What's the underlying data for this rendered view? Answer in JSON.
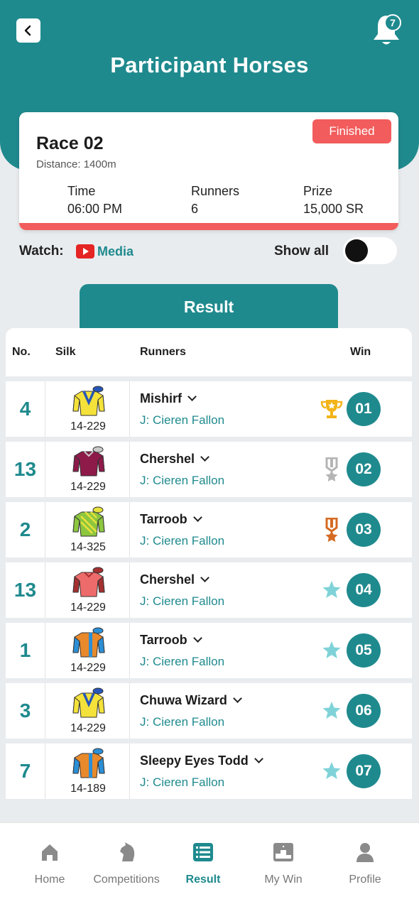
{
  "header": {
    "title": "Participant Horses",
    "notification_count": "7",
    "accent": "#1f8a8e"
  },
  "race": {
    "name": "Race 02",
    "distance": "Distance: 1400m",
    "status": "Finished",
    "time_label": "Time",
    "time_value": "06:00 PM",
    "runners_label": "Runners",
    "runners_value": "6",
    "prize_label": "Prize",
    "prize_value": "15,000 SR"
  },
  "watch": {
    "label": "Watch:",
    "media": "Media",
    "show_all": "Show all",
    "show_all_on": false
  },
  "result_tab": "Result",
  "table": {
    "headers": {
      "no": "No.",
      "silk": "Silk",
      "runners": "Runners",
      "win": "Win"
    },
    "rows": [
      {
        "no": "4",
        "silk_code": "14-229",
        "horse": "Mishirf",
        "jockey": "J: Cieren Fallon",
        "position": "01",
        "award": "gold-trophy-icon",
        "silk": "yellow-blue-chevron"
      },
      {
        "no": "13",
        "silk_code": "14-229",
        "horse": "Chershel",
        "jockey": "J: Cieren Fallon",
        "position": "02",
        "award": "silver-medal-icon",
        "silk": "maroon"
      },
      {
        "no": "2",
        "silk_code": "14-325",
        "horse": "Tarroob",
        "jockey": "J: Cieren Fallon",
        "position": "03",
        "award": "bronze-medal-icon",
        "silk": "green-striped"
      },
      {
        "no": "13",
        "silk_code": "14-229",
        "horse": "Chershel",
        "jockey": "J: Cieren Fallon",
        "position": "04",
        "award": "star-icon",
        "silk": "salmon"
      },
      {
        "no": "1",
        "silk_code": "14-229",
        "horse": "Tarroob",
        "jockey": "J: Cieren Fallon",
        "position": "05",
        "award": "star-icon",
        "silk": "orange-blue"
      },
      {
        "no": "3",
        "silk_code": "14-229",
        "horse": "Chuwa Wizard",
        "jockey": "J: Cieren Fallon",
        "position": "06",
        "award": "star-icon",
        "silk": "yellow-blue-chevron"
      },
      {
        "no": "7",
        "silk_code": "14-189",
        "horse": "Sleepy Eyes Todd",
        "jockey": "J: Cieren Fallon",
        "position": "07",
        "award": "star-icon",
        "silk": "orange-blue"
      }
    ]
  },
  "nav": [
    {
      "label": "Home",
      "icon": "home-icon",
      "active": false
    },
    {
      "label": "Competitions",
      "icon": "horse-head-icon",
      "active": false
    },
    {
      "label": "Result",
      "icon": "list-icon",
      "active": true
    },
    {
      "label": "My Win",
      "icon": "podium-icon",
      "active": false
    },
    {
      "label": "Profile",
      "icon": "user-icon",
      "active": false
    }
  ]
}
